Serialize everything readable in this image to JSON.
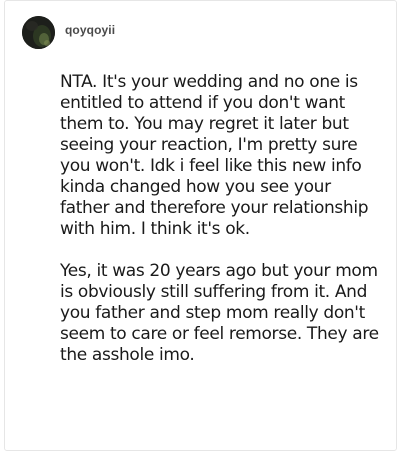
{
  "post": {
    "username": "qoyqoyii",
    "avatar": {
      "icon": "user-avatar-icon",
      "colors": [
        "#1d1f1b",
        "#3b4a2e",
        "#6b7a4a"
      ]
    },
    "paragraphs": [
      "NTA. It's your wedding and no one is entitled to attend if you don't want them to. You may regret it later but seeing your reaction, I'm pretty sure you won't. Idk i feel like this new info kinda changed how you see your father and therefore your relationship with him. I think it's ok.",
      "Yes, it was 20 years ago but your mom is obviously still suffering from it. And you father and step mom really don't seem to care or feel remorse. They are the asshole imo."
    ]
  }
}
